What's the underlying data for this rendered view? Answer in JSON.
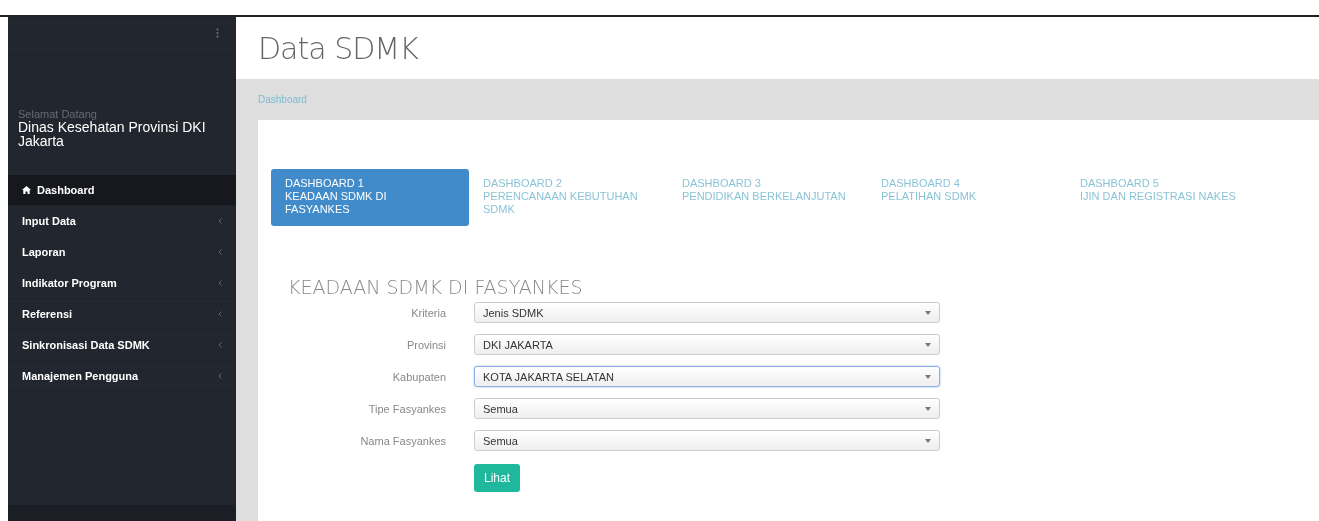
{
  "page": {
    "title": "Data SDMK"
  },
  "sidebar": {
    "greeting": "Selamat Datang",
    "user": "Dinas Kesehatan Provinsi DKI Jakarta",
    "items": [
      {
        "label": "Dashboard",
        "selected": true,
        "kind": "link"
      },
      {
        "label": "Input Data",
        "selected": false,
        "kind": "submenu"
      },
      {
        "label": "Laporan",
        "selected": false,
        "kind": "submenu"
      },
      {
        "label": "Indikator Program",
        "selected": false,
        "kind": "submenu"
      },
      {
        "label": "Referensi",
        "selected": false,
        "kind": "submenu"
      },
      {
        "label": "Sinkronisasi Data SDMK",
        "selected": false,
        "kind": "submenu"
      },
      {
        "label": "Manajemen Pengguna",
        "selected": false,
        "kind": "submenu"
      }
    ]
  },
  "breadcrumb": [
    "Dashboard"
  ],
  "tabs": [
    {
      "title": "DASHBOARD 1",
      "subtitle": "KEADAAN SDMK DI FASYANKES",
      "selected": true
    },
    {
      "title": "DASHBOARD 2",
      "subtitle": "PERENCANAAN KEBUTUHAN SDMK",
      "selected": false
    },
    {
      "title": "DASHBOARD 3",
      "subtitle": "PENDIDIKAN BERKELANJUTAN",
      "selected": false
    },
    {
      "title": "DASHBOARD 4",
      "subtitle": "PELATIHAN SDMK",
      "selected": false
    },
    {
      "title": "DASHBOARD 5",
      "subtitle": "IJIN DAN REGISTRASI NAKES",
      "selected": false
    }
  ],
  "form": {
    "heading": "KEADAAN SDMK DI FASYANKES",
    "fields": [
      {
        "label": "Kriteria",
        "value": "Jenis SDMK",
        "focused": false
      },
      {
        "label": "Provinsi",
        "value": "DKI JAKARTA",
        "focused": false
      },
      {
        "label": "Kabupaten",
        "value": "KOTA JAKARTA SELATAN",
        "focused": true
      },
      {
        "label": "Tipe Fasyankes",
        "value": "Semua",
        "focused": false
      },
      {
        "label": "Nama Fasyankes",
        "value": "Semua",
        "focused": false
      }
    ],
    "submit": "Lihat"
  }
}
